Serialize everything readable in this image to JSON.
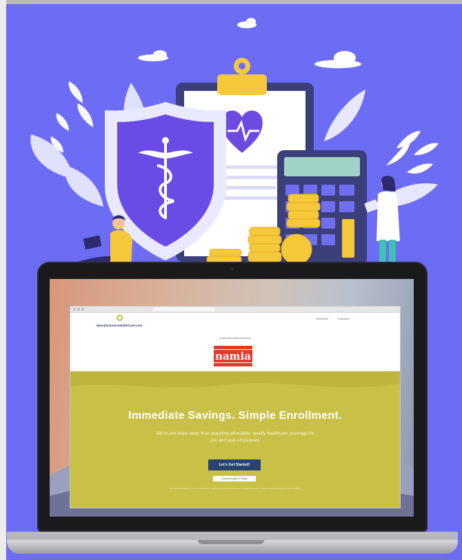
{
  "screen": {
    "logo_text": "ManufacturersHealthCare.com",
    "nav": [
      "Employees",
      "Employers"
    ],
    "sponsor_note": "an approved benefit provided by",
    "sponsor_badge": "namia",
    "headline": "Immediate Savings. Simple Enrollment.",
    "subheadline": "We're just steps away from acquiring affordable, quality healthcare coverage for you and your employees.",
    "cta_label": "Let's Get Started!",
    "secondary_label": "Download Quote & Details",
    "fine_print": "ManufacturersHealthCare.com is an association health plan provided by NAMIA and its affiliated members, subject to applicable plan terms and conditions."
  },
  "colors": {
    "background": "#6d6cf4",
    "hero_band": "#c9c047",
    "cta": "#27436e",
    "badge": "#e23a2f"
  },
  "icons": [
    "cloud-icon",
    "shield-caduceus-icon",
    "clipboard-heart-icon",
    "calculator-icon",
    "coin-stack-icon",
    "leaf-icon",
    "person-laptop-icon",
    "doctor-icon"
  ]
}
